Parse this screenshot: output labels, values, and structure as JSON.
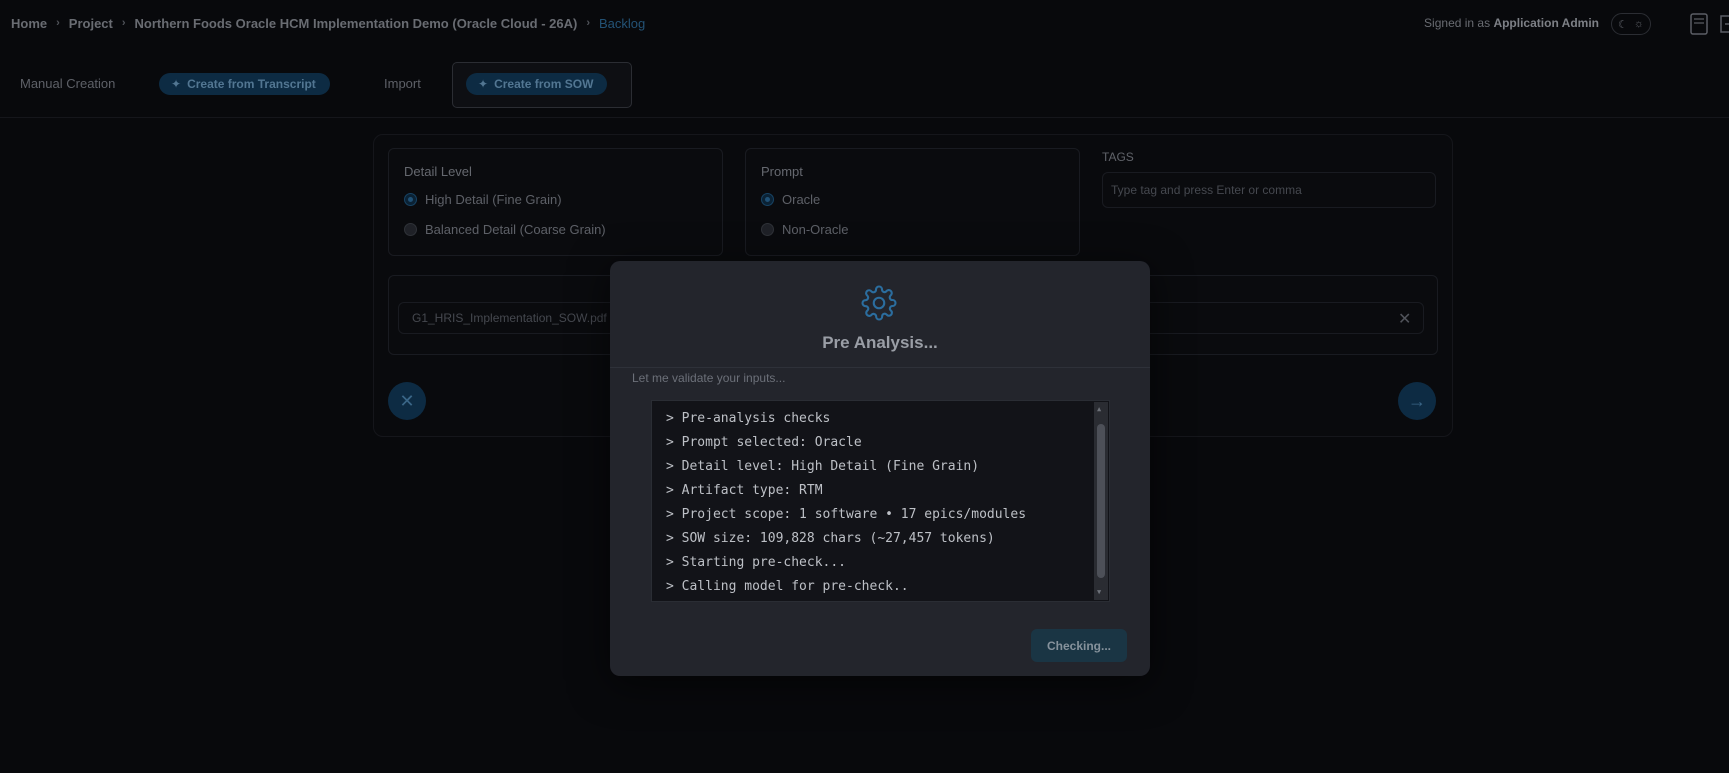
{
  "breadcrumb": {
    "items": [
      "Home",
      "Project",
      "Northern Foods Oracle HCM Implementation Demo (Oracle Cloud - 26A)"
    ],
    "current": "Backlog"
  },
  "header": {
    "signed_in_prefix": "Signed in as",
    "user": "Application Admin"
  },
  "tabs": {
    "manual": "Manual Creation",
    "transcript": "Create from Transcript",
    "import": "Import",
    "sow": "Create from SOW"
  },
  "form": {
    "detail_level": {
      "title": "Detail Level",
      "options": [
        "High Detail (Fine Grain)",
        "Balanced Detail (Coarse Grain)"
      ],
      "selected": "High Detail (Fine Grain)"
    },
    "prompt": {
      "title": "Prompt",
      "options": [
        "Oracle",
        "Non-Oracle"
      ],
      "selected": "Oracle"
    },
    "tags": {
      "label": "TAGS",
      "placeholder": "Type tag and press Enter or comma"
    },
    "file_name": "G1_HRIS_Implementation_SOW.pdf"
  },
  "modal": {
    "title": "Pre Analysis...",
    "subtitle": "Let me validate your inputs...",
    "log": [
      "> Pre-analysis checks",
      "> Prompt selected: Oracle",
      "> Detail level: High Detail (Fine Grain)",
      "> Artifact type: RTM",
      "> Project scope: 1 software • 17 epics/modules",
      "> SOW size: 109,828 chars (~27,457 tokens)",
      "> Starting pre-check...",
      "> Calling model for pre-check.."
    ],
    "button": "Checking..."
  },
  "colors": {
    "accent": "#2b6d9e",
    "modal_bg": "#23252c",
    "page_bg": "#0b0c10"
  }
}
